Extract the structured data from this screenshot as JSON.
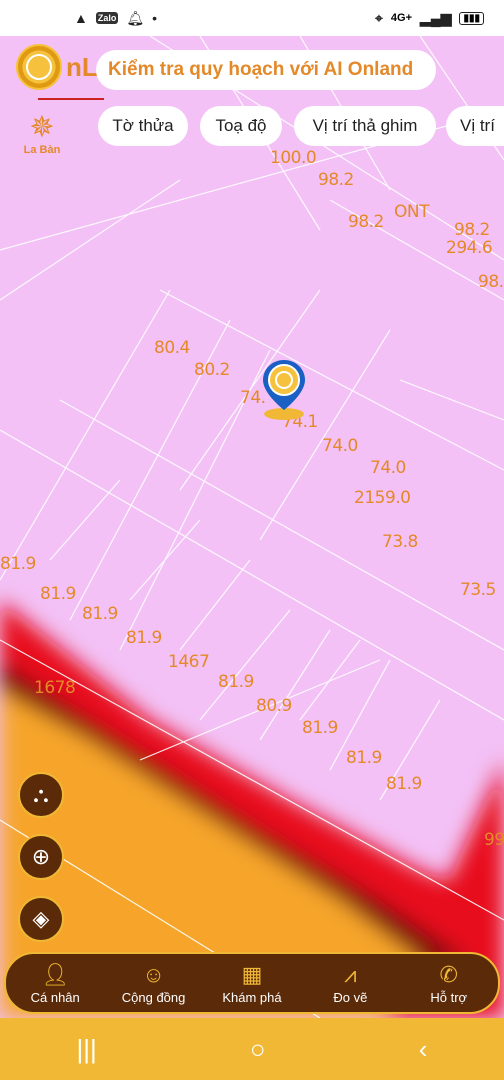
{
  "status": {
    "network": "4G+",
    "zalo": "Zalo"
  },
  "app": {
    "logo_text": "nL",
    "search_placeholder": "Kiểm tra quy hoạch với AI Onland",
    "compass_label": "La Bàn"
  },
  "chips": [
    "Tờ thửa",
    "Toạ độ",
    "Vị trí thả ghim",
    "Vị trí"
  ],
  "map_labels": [
    {
      "text": "100.0"
    },
    {
      "text": "98.2"
    },
    {
      "text": "98.2"
    },
    {
      "text": "ONT"
    },
    {
      "text": "98.2"
    },
    {
      "text": "294.6"
    },
    {
      "text": "98."
    },
    {
      "text": "80.4"
    },
    {
      "text": "80.2"
    },
    {
      "text": "74."
    },
    {
      "text": "74.1"
    },
    {
      "text": "74.0"
    },
    {
      "text": "74.0"
    },
    {
      "text": "2159.0"
    },
    {
      "text": "73.8"
    },
    {
      "text": "73.5"
    },
    {
      "text": "81.9"
    },
    {
      "text": "81.9"
    },
    {
      "text": "81.9"
    },
    {
      "text": "81.9"
    },
    {
      "text": "1467"
    },
    {
      "text": "81.9"
    },
    {
      "text": "80.9"
    },
    {
      "text": "81.9"
    },
    {
      "text": "81.9"
    },
    {
      "text": "81.9"
    },
    {
      "text": "1678"
    },
    {
      "text": "99"
    }
  ],
  "nav": [
    {
      "label": "Cá nhân",
      "icon": "person-icon"
    },
    {
      "label": "Cộng đồng",
      "icon": "community-icon"
    },
    {
      "label": "Khám phá",
      "icon": "explore-grid-icon"
    },
    {
      "label": "Đo vẽ",
      "icon": "measure-icon"
    },
    {
      "label": "Hỗ trợ",
      "icon": "phone-icon"
    }
  ],
  "colors": {
    "map_bg": "#f3c1f6",
    "accent": "#f0b834",
    "label": "#e4892a",
    "nav_bg": "#5b2a08",
    "zone_red": "#e8111a",
    "zone_orange": "#f6a52a"
  }
}
